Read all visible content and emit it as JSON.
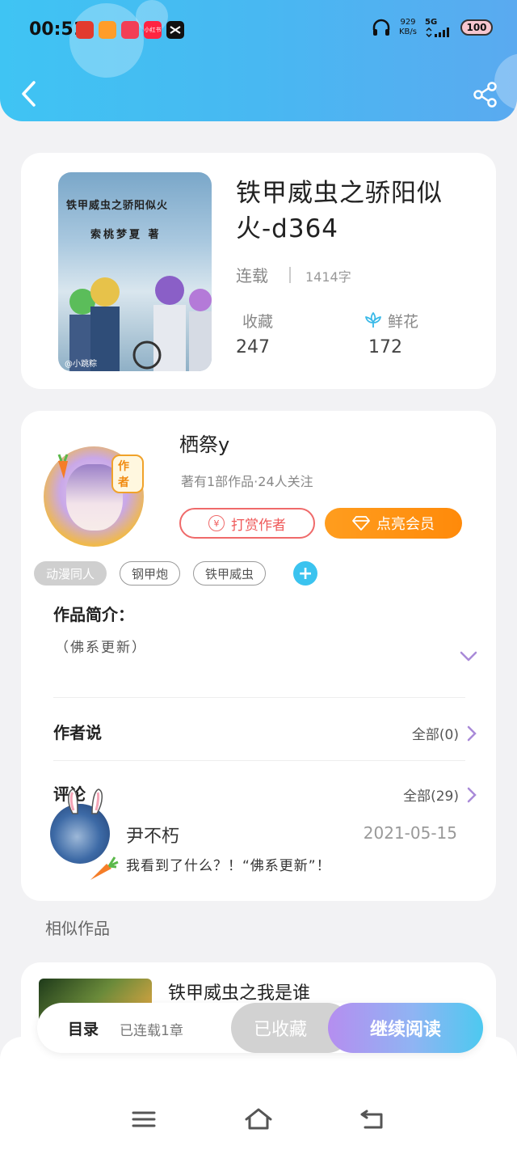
{
  "status_bar": {
    "time": "00:51",
    "apps": [
      "app-icon-1",
      "app-icon-2",
      "app-icon-3",
      "小红书",
      "capcut"
    ],
    "speed_value": "929",
    "speed_unit": "KB/s",
    "network": "5G",
    "battery": "100"
  },
  "header": {
    "back_icon": "chevron-left-icon",
    "share_icon": "share-icon"
  },
  "book": {
    "cover_title": "铁甲威虫之骄阳似火",
    "cover_author": "索桃梦夏 著",
    "cover_watermark": "@小跳粽",
    "title": "铁甲威虫之骄阳似火-d364",
    "status": "连载",
    "words": "1414字",
    "favorites_label": "收藏",
    "favorites_value": "247",
    "flowers_label": "鲜花",
    "flowers_value": "172"
  },
  "author": {
    "badge": "作者",
    "name": "栖祭y",
    "meta": "著有1部作品·24人关注",
    "tip_label": "打赏作者",
    "tip_icon": "¥",
    "vip_label": "点亮会员"
  },
  "tags": [
    "动漫同人",
    "钢甲炮",
    "铁甲威虫"
  ],
  "intro": {
    "title": "作品简介：",
    "text": "（佛系更新）"
  },
  "author_says": {
    "title": "作者说",
    "all": "全部(0)"
  },
  "comments": {
    "title": "评论",
    "all": "全部(29)",
    "items": [
      {
        "user": "尹不朽",
        "date": "2021-05-15",
        "text": "我看到了什么？！“佛系更新”！"
      }
    ]
  },
  "similar": {
    "title": "相似作品",
    "items": [
      {
        "name": "铁甲威虫之我是谁"
      }
    ]
  },
  "read_bar": {
    "toc_label": "目录",
    "toc_sub": "已连载1章",
    "fav_label": "已收藏",
    "read_label": "继续阅读"
  },
  "colors": {
    "accent": "#3bc3ef",
    "vip": "#ff8a0a",
    "tip": "#ef5a5a",
    "arrow": "#a98ad8"
  }
}
